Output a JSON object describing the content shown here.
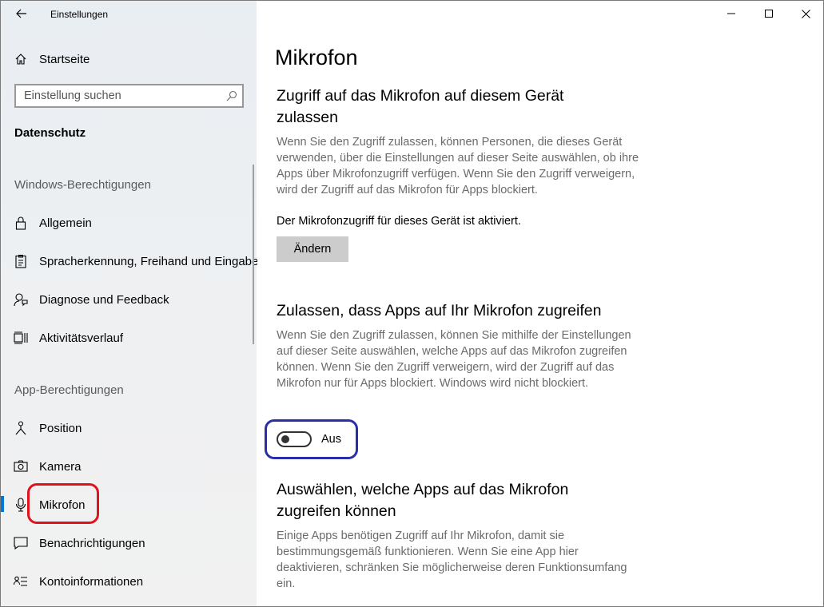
{
  "window": {
    "title": "Einstellungen",
    "controls": [
      "minimize",
      "maximize",
      "close"
    ]
  },
  "sidebar": {
    "home_label": "Startseite",
    "search_placeholder": "Einstellung suchen",
    "category": "Datenschutz",
    "section_windows": "Windows-Berechtigungen",
    "windows_items": [
      {
        "label": "Allgemein",
        "icon": "lock-icon"
      },
      {
        "label": "Spracherkennung, Freihand und Eingabe",
        "icon": "clipboard-icon"
      },
      {
        "label": "Diagnose und Feedback",
        "icon": "feedback-icon"
      },
      {
        "label": "Aktivitätsverlauf",
        "icon": "timeline-icon"
      }
    ],
    "section_apps": "App-Berechtigungen",
    "app_items": [
      {
        "label": "Position",
        "icon": "location-icon"
      },
      {
        "label": "Kamera",
        "icon": "camera-icon"
      },
      {
        "label": "Mikrofon",
        "icon": "microphone-icon",
        "selected": true
      },
      {
        "label": "Benachrichtigungen",
        "icon": "notification-icon"
      },
      {
        "label": "Kontoinformationen",
        "icon": "account-info-icon"
      }
    ]
  },
  "main": {
    "title": "Mikrofon",
    "section1": {
      "heading": "Zugriff auf das Mikrofon auf diesem Gerät zulassen",
      "description": "Wenn Sie den Zugriff zulassen, können Personen, die dieses Gerät verwenden, über die Einstellungen auf dieser Seite auswählen, ob ihre Apps über Mikrofonzugriff verfügen. Wenn Sie den Zugriff verweigern, wird der Zugriff auf das Mikrofon für Apps blockiert.",
      "status": "Der Mikrofonzugriff für dieses Gerät ist aktiviert.",
      "button": "Ändern"
    },
    "section2": {
      "heading": "Zulassen, dass Apps auf Ihr Mikrofon zugreifen",
      "description": "Wenn Sie den Zugriff zulassen, können Sie mithilfe der Einstellungen auf dieser Seite auswählen, welche Apps auf das Mikrofon zugreifen können. Wenn Sie den Zugriff verweigern, wird der Zugriff auf das Mikrofon nur für Apps blockiert. Windows wird nicht blockiert.",
      "toggle_state": "Aus",
      "toggle_on": false
    },
    "section3": {
      "heading": "Auswählen, welche Apps auf das Mikrofon zugreifen können",
      "description": "Einige Apps benötigen Zugriff auf Ihr Mikrofon, damit sie bestimmungsgemäß funktionieren. Wenn Sie eine App hier deaktivieren, schränken Sie möglicherweise deren Funktionsumfang ein."
    }
  },
  "colors": {
    "accent": "#0078d7",
    "annotation_red": "#e0131c",
    "annotation_blue": "#2a2fa8"
  }
}
